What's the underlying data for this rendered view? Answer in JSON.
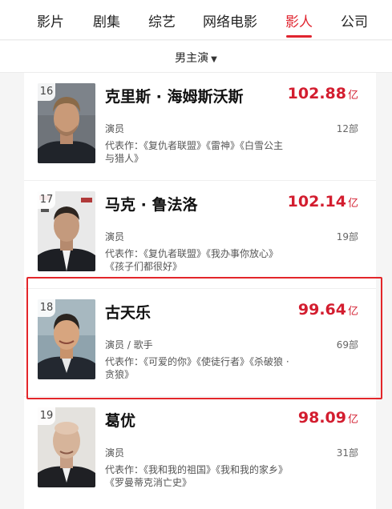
{
  "tabs": [
    {
      "label": "影片"
    },
    {
      "label": "剧集"
    },
    {
      "label": "综艺"
    },
    {
      "label": "网络电影"
    },
    {
      "label": "影人",
      "active": true
    },
    {
      "label": "公司"
    }
  ],
  "filter": {
    "label": "男主演",
    "icon": "dropdown-triangle-icon"
  },
  "colors": {
    "accent": "#e0242f",
    "value": "#d31d2f",
    "highlight_box": "#e3262a"
  },
  "actors": [
    {
      "rank": "16",
      "name": "克里斯 · 海姆斯沃斯",
      "value": "102.88",
      "unit": "亿",
      "role": "演员",
      "count": "12部",
      "works": "代表作：《复仇者联盟》《雷神》《白雪公主与猎人》"
    },
    {
      "rank": "17",
      "name": "马克 · 鲁法洛",
      "value": "102.14",
      "unit": "亿",
      "role": "演员",
      "count": "19部",
      "works": "代表作：《复仇者联盟》《我办事你放心》《孩子们都很好》"
    },
    {
      "rank": "18",
      "name": "古天乐",
      "value": "99.64",
      "unit": "亿",
      "role": "演员 / 歌手",
      "count": "69部",
      "works": "代表作：《可爱的你》《使徒行者》《杀破狼 · 贪狼》",
      "highlighted": true
    },
    {
      "rank": "19",
      "name": "葛优",
      "value": "98.09",
      "unit": "亿",
      "role": "演员",
      "count": "31部",
      "works": "代表作：《我和我的祖国》《我和我的家乡》《罗曼蒂克消亡史》"
    }
  ]
}
